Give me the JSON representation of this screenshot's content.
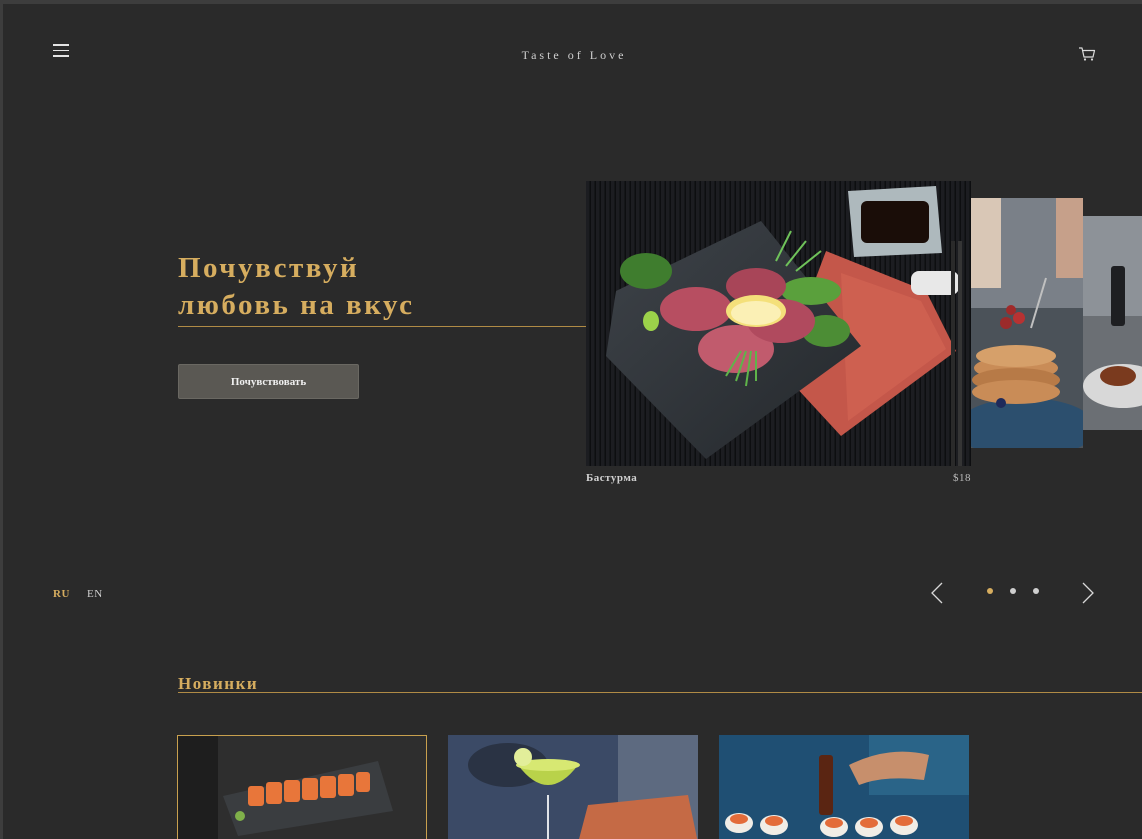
{
  "header": {
    "logo": "Taste of Love",
    "menu_icon": "hamburger-menu-icon",
    "cart_icon": "shopping-cart-icon"
  },
  "hero": {
    "title_line1": "Почувствуй",
    "title_line2": "любовь на вкус",
    "button_label": "Почувствовать"
  },
  "slider": {
    "main_item": {
      "name": "Бастурма",
      "price": "$18"
    },
    "dots": 3,
    "active_dot": 1,
    "prev_icon": "chevron-left-icon",
    "next_icon": "chevron-right-icon"
  },
  "languages": {
    "ru": "RU",
    "en": "EN",
    "active": "RU"
  },
  "new_items": {
    "title": "Новинки"
  },
  "colors": {
    "background": "#2a2a2a",
    "accent_gold": "#d6ad5f",
    "button_bg": "#5a5853"
  }
}
